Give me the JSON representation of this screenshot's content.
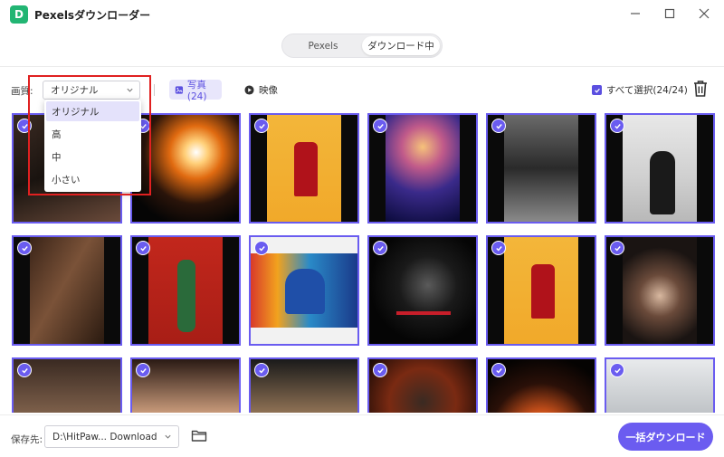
{
  "window": {
    "title": "Pexelsダウンローダー",
    "logo_letter": "D",
    "brand_color": "#22b573"
  },
  "tabs": [
    {
      "label": "Pexels"
    },
    {
      "label": "ダウンロード中"
    }
  ],
  "toolbar": {
    "quality_label": "画質:",
    "quality_value": "オリジナル",
    "photo_filter_label": "写真(24)",
    "video_filter_label": "映像",
    "select_all_label": "すべて選択(24/24)",
    "accent_color": "#6a5cf0"
  },
  "quality_dropdown": {
    "options": [
      "オリジナル",
      "高",
      "中",
      "小さい"
    ],
    "selected": "オリジナル"
  },
  "footer": {
    "save_label": "保存先:",
    "save_path": "D:\\HitPaw... Download",
    "download_all_label": "一括ダウンロード"
  }
}
